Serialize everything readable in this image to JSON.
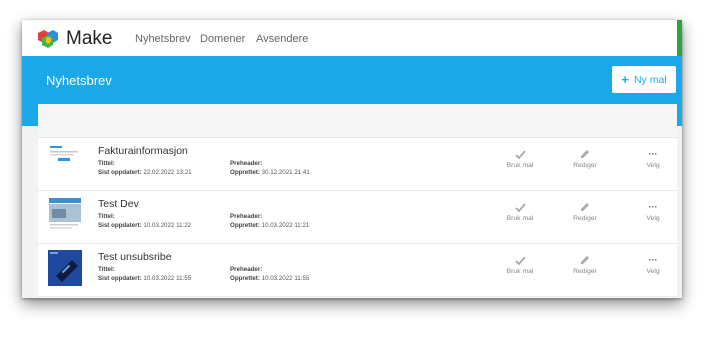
{
  "app": {
    "brand": "Make"
  },
  "nav": {
    "items": [
      "Nyhetsbrev",
      "Domener",
      "Avsendere"
    ]
  },
  "header": {
    "title": "Nyhetsbrev",
    "new_button_label": "Ny mal"
  },
  "labels": {
    "title": "Tittel:",
    "updated": "Sist oppdatert:",
    "preheader": "Preheader:",
    "created": "Opprettet:",
    "use": "Bruk mal",
    "edit": "Rediger",
    "choose": "Velg",
    "more": "···"
  },
  "templates": [
    {
      "name": "Fakturainformasjon",
      "updated": "22.02.2022 13:21",
      "created": "30.12.2021 21:41"
    },
    {
      "name": "Test Dev",
      "updated": "10.03.2022 11:22",
      "created": "10.03.2022 11:21"
    },
    {
      "name": "Test unsubsribe",
      "updated": "10.03.2022 11:55",
      "created": "10.03.2022 11:55"
    }
  ],
  "colors": {
    "accent": "#1ba8e8",
    "green_strip": "#27a744"
  }
}
